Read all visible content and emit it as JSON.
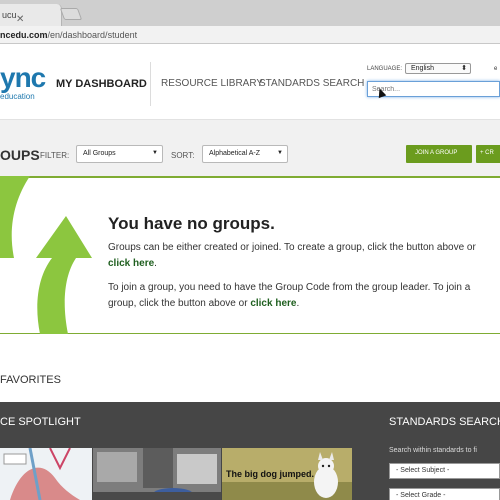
{
  "browser": {
    "tab_title": "ucu",
    "url_host": "ncedu.com",
    "url_path": "/en/dashboard/student"
  },
  "logo": {
    "text": "ync",
    "subtitle": "education"
  },
  "nav": {
    "items": [
      {
        "label": "MY DASHBOARD",
        "active": true
      },
      {
        "label": "RESOURCE LIBRARY",
        "active": false
      },
      {
        "label": "STANDARDS SEARCH",
        "active": false
      }
    ]
  },
  "header": {
    "language_label": "LANGUAGE:",
    "language_value": "English",
    "right_link": "e",
    "search_placeholder": "Search..."
  },
  "toolbar": {
    "title": "OUPS",
    "filter_label": "FILTER:",
    "filter_value": "All Groups",
    "sort_label": "SORT:",
    "sort_value": "Alphabetical A-Z",
    "join_button": "JOIN A GROUP",
    "create_button": "+ CR"
  },
  "empty_state": {
    "title": "You have no groups.",
    "para1_text": "Groups can be either created or joined. To create a group, click the button above or",
    "para1_link": "click here",
    "para1_end": ".",
    "para2_text": "To join a group, you need to have the Group Code from the group leader. To join a group, click the button above or",
    "para2_link": "click here",
    "para2_end": "."
  },
  "favorites": {
    "title": "FAVORITES"
  },
  "spotlight": {
    "title": "CE SPOTLIGHT",
    "thumb3_caption": "The big dog jumped."
  },
  "standards_search": {
    "title": "STANDARDS SEARCH",
    "hint": "Search within standards to fi",
    "subject_select": "- Select Subject -",
    "grade_select": "- Select Grade -"
  },
  "colors": {
    "brand_blue": "#1e78ae",
    "accent_green": "#6b9c1e",
    "arrow_green": "#8cc63f",
    "spotlight_bg": "#464646"
  }
}
